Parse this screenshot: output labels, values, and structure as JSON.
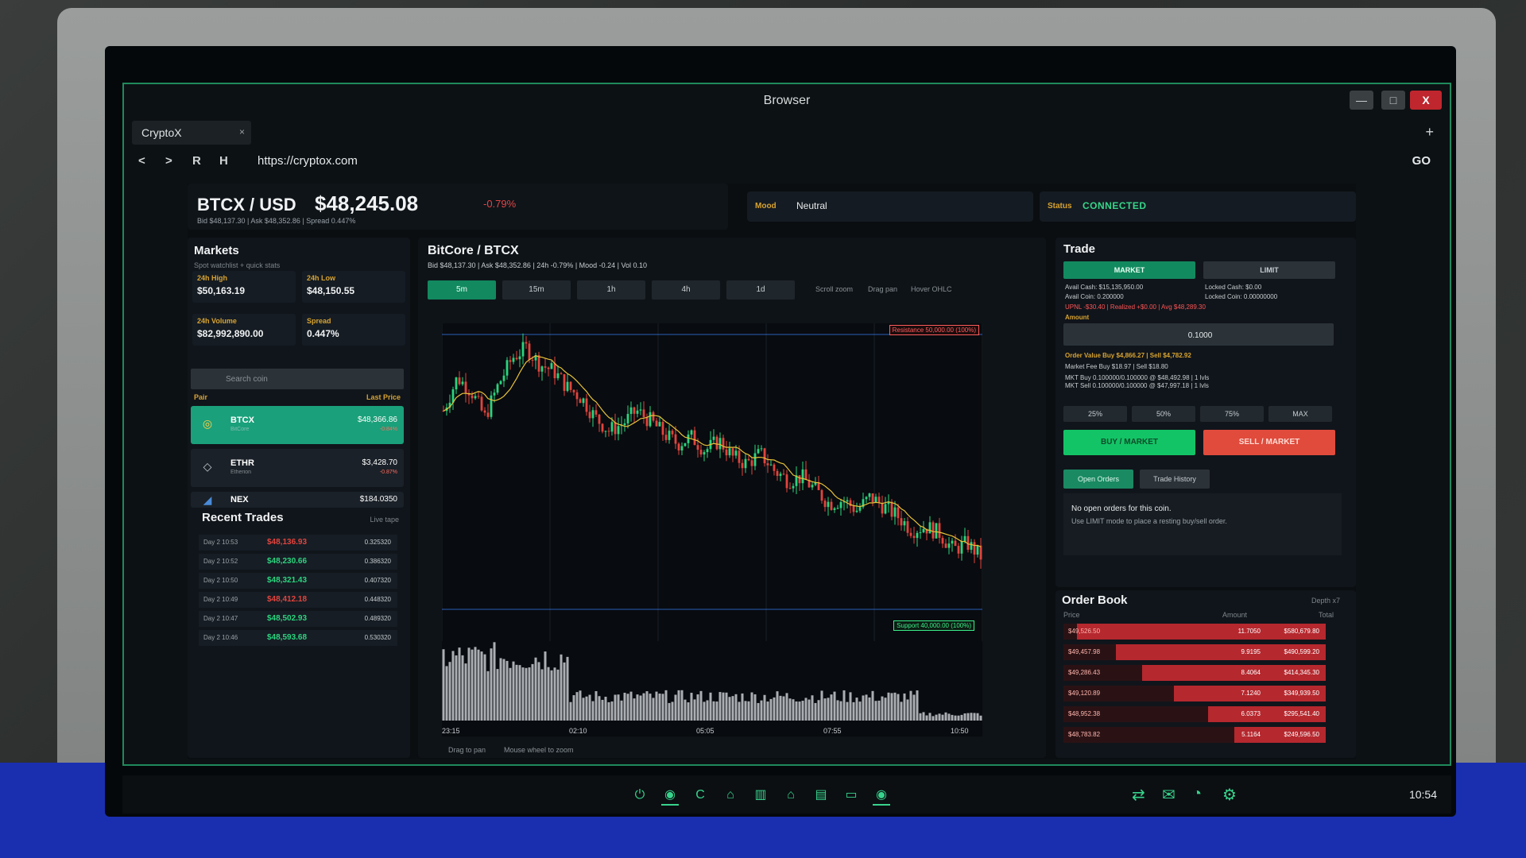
{
  "window": {
    "title": "Browser",
    "min": "—",
    "max": "□",
    "close": "X"
  },
  "tab": {
    "label": "CryptoX",
    "close": "×",
    "new": "+"
  },
  "nav": {
    "back": "<",
    "forward": ">",
    "reload": "R",
    "home": "H",
    "url": "https://cryptox.com",
    "go": "GO"
  },
  "ticker": {
    "pair": "BTCX / USD",
    "price": "$48,245.08",
    "change": "-0.79%",
    "subline": "Bid $48,137.30  |  Ask $48,352.86  |  Spread 0.447%",
    "mood_label": "Mood",
    "mood_value": "Neutral",
    "status_label": "Status",
    "status_value": "CONNECTED"
  },
  "markets": {
    "title": "Markets",
    "subtitle": "Spot watchlist + quick stats",
    "stats": [
      {
        "label": "24h High",
        "value": "$50,163.19"
      },
      {
        "label": "24h Low",
        "value": "$48,150.55"
      },
      {
        "label": "24h Volume",
        "value": "$82,992,890.00"
      },
      {
        "label": "Spread",
        "value": "0.447%"
      }
    ],
    "search_placeholder": "Search coin",
    "col_pair": "Pair",
    "col_price": "Last Price",
    "coins": [
      {
        "symbol": "BTCX",
        "name": "BitCore",
        "price": "$48,366.86",
        "change": "-0.84%",
        "icon": "btc-coin-icon"
      },
      {
        "symbol": "ETHR",
        "name": "Etherion",
        "price": "$3,428.70",
        "change": "-0.87%",
        "icon": "eth-diamond-icon"
      },
      {
        "symbol": "NEX",
        "name": "",
        "price": "$184.0350",
        "change": "",
        "icon": "nex-coin-icon"
      }
    ]
  },
  "recent_trades": {
    "title": "Recent Trades",
    "subtitle": "Live tape",
    "rows": [
      {
        "time": "Day 2 10:53",
        "price": "$48,136.93",
        "amount": "0.325320",
        "side": "sell"
      },
      {
        "time": "Day 2 10:52",
        "price": "$48,230.66",
        "amount": "0.386320",
        "side": "buy"
      },
      {
        "time": "Day 2 10:50",
        "price": "$48,321.43",
        "amount": "0.407320",
        "side": "buy"
      },
      {
        "time": "Day 2 10:49",
        "price": "$48,412.18",
        "amount": "0.448320",
        "side": "sell"
      },
      {
        "time": "Day 2 10:47",
        "price": "$48,502.93",
        "amount": "0.489320",
        "side": "buy"
      },
      {
        "time": "Day 2 10:46",
        "price": "$48,593.68",
        "amount": "0.530320",
        "side": "buy"
      }
    ]
  },
  "chart": {
    "title": "BitCore / BTCX",
    "subline": "Bid $48,137.30  |  Ask $48,352.86  |  24h -0.79%  |  Mood -0.24  |  Vol 0.10",
    "timeframes": [
      "5m",
      "15m",
      "1h",
      "4h",
      "1d"
    ],
    "active_timeframe": "5m",
    "hint_1": "Scroll zoom",
    "hint_2": "Drag pan",
    "hint_3": "Hover OHLC",
    "resistance_label": "Resistance 50,000.00 (100%)",
    "support_label": "Support 40,000.00 (100%)",
    "x_ticks": [
      "23:15",
      "02:10",
      "05:05",
      "07:55",
      "10:50"
    ],
    "drag_hint": "Drag to pan",
    "wheel_hint": "Mouse wheel to zoom",
    "colors": {
      "up": "#2bd47e",
      "down": "#e2443e",
      "ma": "#e8c23a",
      "volume": "#c8ccd0"
    }
  },
  "chart_data": {
    "type": "candlestick",
    "x_ticks": [
      "23:15",
      "02:10",
      "05:05",
      "07:55",
      "10:50"
    ],
    "resistance": 50000,
    "support": 40000,
    "trend": "downtrend from ~49,600 to ~48,250 with a sharp early rally then steady decline",
    "close_points": [
      48700,
      49200,
      49000,
      48600,
      49100,
      49500,
      49650,
      49400,
      49300,
      49050,
      48900,
      48600,
      48400,
      48500,
      48700,
      48550,
      48350,
      48200,
      48300,
      48100,
      48250,
      48000,
      47900,
      48050,
      47800,
      47650,
      47700,
      47500,
      47300,
      47350,
      47200,
      47400,
      47250,
      47100,
      46900,
      46950,
      46850,
      46600,
      46700,
      46500
    ]
  },
  "trade": {
    "title": "Trade",
    "mode_market": "MARKET",
    "mode_limit": "LIMIT",
    "avail_cash": "Avail Cash: $15,135,950.00",
    "avail_coin": "Avail Coin: 0.200000",
    "locked_cash": "Locked Cash: $0.00",
    "locked_coin": "Locked Coin: 0.00000000",
    "pnl": "UPNL -$30.40   |   Realized +$0.00   |   Avg $48,289.30",
    "amount_label": "Amount",
    "amount_value": "0.1000",
    "order_value": "Order Value   Buy $4,866.27   |   Sell $4,782.92",
    "market_fee": "Market Fee   Buy $18.97   |   Sell $18.80",
    "mkt_buy": "MKT Buy 0.100000/0.100000 @ $48,492.98  |  1 lvls",
    "mkt_sell": "MKT Sell 0.100000/0.100000 @ $47,997.18  |  1 lvls",
    "pct_buttons": [
      "25%",
      "50%",
      "75%",
      "MAX"
    ],
    "buy_label": "BUY / MARKET",
    "sell_label": "SELL / MARKET",
    "tab_open": "Open Orders",
    "tab_history": "Trade History",
    "no_orders": "No open orders for this coin.",
    "no_orders_hint": "Use LIMIT mode to place a resting buy/sell order."
  },
  "order_book": {
    "title": "Order Book",
    "depth": "Depth x7",
    "col_price": "Price",
    "col_amount": "Amount",
    "col_total": "Total",
    "rows": [
      {
        "price": "$49,526.50",
        "amount": "11.7050",
        "total": "$580,679.80",
        "fill": 0.95
      },
      {
        "price": "$49,457.98",
        "amount": "9.9195",
        "total": "$490,599.20",
        "fill": 0.8
      },
      {
        "price": "$49,286.43",
        "amount": "8.4064",
        "total": "$414,345.30",
        "fill": 0.7
      },
      {
        "price": "$49,120.89",
        "amount": "7.1240",
        "total": "$349,939.50",
        "fill": 0.58
      },
      {
        "price": "$48,952.38",
        "amount": "6.0373",
        "total": "$295,541.40",
        "fill": 0.45
      },
      {
        "price": "$48,783.82",
        "amount": "5.1164",
        "total": "$249,596.50",
        "fill": 0.35
      }
    ]
  },
  "taskbar": {
    "icons": [
      "power-icon",
      "globe-icon",
      "refresh-icon",
      "bank-icon",
      "chart-icon",
      "home-icon",
      "clipboard-icon",
      "folder-icon",
      "network-icon"
    ],
    "clock": "10:54"
  }
}
